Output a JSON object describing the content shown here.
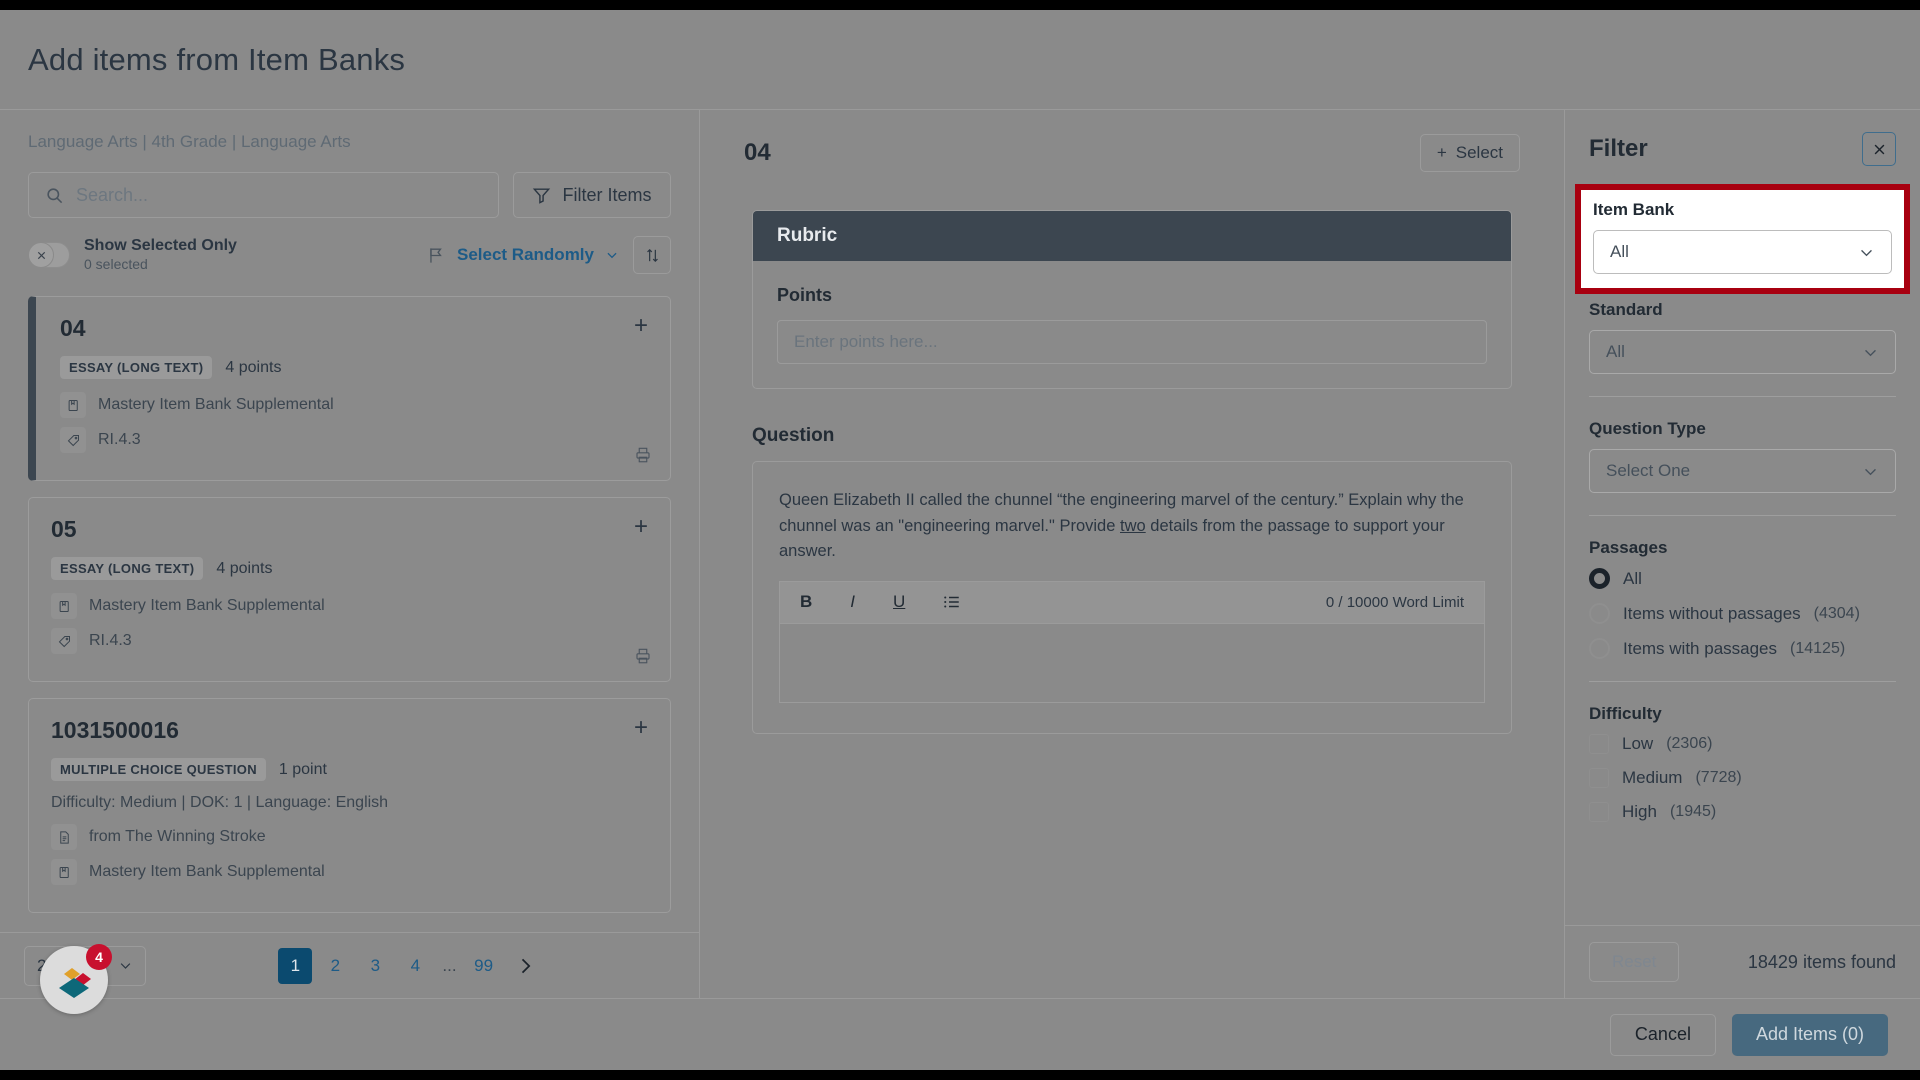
{
  "modal": {
    "title": "Add items from Item Banks"
  },
  "left": {
    "breadcrumb": "Language Arts | 4th Grade | Language Arts",
    "search": {
      "value": "",
      "placeholder": "Search..."
    },
    "filter_items_label": "Filter Items",
    "show_selected_only": {
      "label": "Show Selected Only",
      "sub_label": "0 selected",
      "state": "off"
    },
    "select_randomly_label": "Select Randomly",
    "items": [
      {
        "id": "04",
        "type": "ESSAY (LONG TEXT)",
        "points": "4 points",
        "bank": "Mastery Item Bank Supplemental",
        "standard": "RI.4.3",
        "selected": true,
        "has_printer": true,
        "detail": "",
        "passage": ""
      },
      {
        "id": "05",
        "type": "ESSAY (LONG TEXT)",
        "points": "4 points",
        "bank": "Mastery Item Bank Supplemental",
        "standard": "RI.4.3",
        "selected": false,
        "has_printer": true,
        "detail": "",
        "passage": ""
      },
      {
        "id": "1031500016",
        "type": "MULTIPLE CHOICE QUESTION",
        "points": "1 point",
        "bank": "Mastery Item Bank Supplemental",
        "standard": "",
        "selected": false,
        "has_printer": false,
        "detail": "Difficulty: Medium  |  DOK: 1  |  Language: English",
        "passage": "from The Winning Stroke"
      }
    ],
    "pagination": {
      "per_page": "25 Items",
      "pages": [
        "1",
        "2",
        "3",
        "4"
      ],
      "ellipsis": "...",
      "last_page": "99",
      "current": "1"
    },
    "float_widget": {
      "badge": "4"
    }
  },
  "center": {
    "item_id": "04",
    "select_label": "Select",
    "rubric": {
      "header": "Rubric",
      "points_label": "Points",
      "points_value": "",
      "points_placeholder": "Enter points here..."
    },
    "question": {
      "label": "Question",
      "text_part1": "Queen Elizabeth II called the chunnel “the engineering marvel of the century.” Explain why the chunnel was an \"engineering marvel.\" Provide ",
      "text_emphasis": "two",
      "text_part2": " details from the passage to support your answer.",
      "toolbar": {
        "bold": "B",
        "italic": "I",
        "underline": "U",
        "list": "list-icon"
      },
      "word_limit": "0 / 10000 Word Limit",
      "answer_value": ""
    }
  },
  "filter": {
    "title": "Filter",
    "close_icon": "close-icon",
    "item_bank": {
      "label": "Item Bank",
      "value": "All",
      "highlighted": true
    },
    "standard": {
      "label": "Standard",
      "value": "All"
    },
    "question_type": {
      "label": "Question Type",
      "value": "Select One"
    },
    "passages": {
      "label": "Passages",
      "options": [
        {
          "label": "All",
          "count": "",
          "selected": true
        },
        {
          "label": "Items without passages",
          "count": "(4304)",
          "selected": false
        },
        {
          "label": "Items with passages",
          "count": "(14125)",
          "selected": false
        }
      ]
    },
    "difficulty": {
      "label": "Difficulty",
      "options": [
        {
          "label": "Low",
          "count": "(2306)",
          "checked": false
        },
        {
          "label": "Medium",
          "count": "(7728)",
          "checked": false
        },
        {
          "label": "High",
          "count": "(1945)",
          "checked": false
        }
      ]
    },
    "reset_label": "Reset",
    "items_found": "18429 items found"
  },
  "actions": {
    "cancel_label": "Cancel",
    "add_items_label": "Add Items (0)"
  },
  "colors": {
    "accent_blue": "#1d5b87",
    "highlight_red": "#a80010",
    "dark_header": "#3c4650",
    "add_button": "#47697f"
  }
}
